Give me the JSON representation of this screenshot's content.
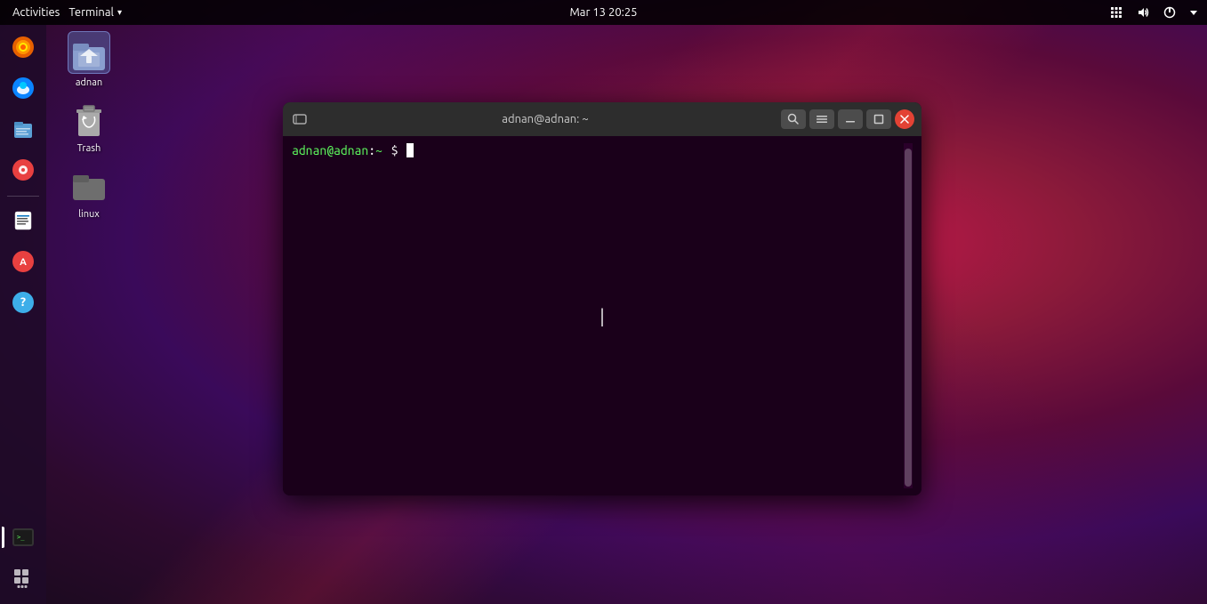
{
  "topbar": {
    "activities_label": "Activities",
    "terminal_label": "Terminal",
    "terminal_arrow": "▾",
    "datetime": "Mar 13  20:25"
  },
  "sidebar": {
    "icons": [
      {
        "name": "firefox-icon",
        "label": "Firefox"
      },
      {
        "name": "thunderbird-icon",
        "label": "Thunderbird"
      },
      {
        "name": "files-icon",
        "label": "Files"
      },
      {
        "name": "rhythmbox-icon",
        "label": "Rhythmbox"
      },
      {
        "name": "libreoffice-writer-icon",
        "label": "LibreOffice Writer"
      },
      {
        "name": "software-icon",
        "label": "Software"
      },
      {
        "name": "help-icon",
        "label": "Help"
      },
      {
        "name": "terminal-icon",
        "label": "Terminal"
      }
    ],
    "apps_grid_label": "Show Applications"
  },
  "desktop": {
    "icons": [
      {
        "name": "home-folder",
        "label": "adnan",
        "selected": true
      },
      {
        "name": "trash",
        "label": "Trash",
        "selected": false
      },
      {
        "name": "linux-folder",
        "label": "linux",
        "selected": false
      }
    ]
  },
  "terminal": {
    "title": "adnan@adnan: ~",
    "prompt_user": "adnan@adnan",
    "prompt_colon": ":",
    "prompt_tilde": "~",
    "prompt_dollar": "$",
    "search_btn": "🔍",
    "menu_btn": "☰",
    "minimize_btn": "—",
    "maximize_btn": "□",
    "close_btn": "×"
  }
}
